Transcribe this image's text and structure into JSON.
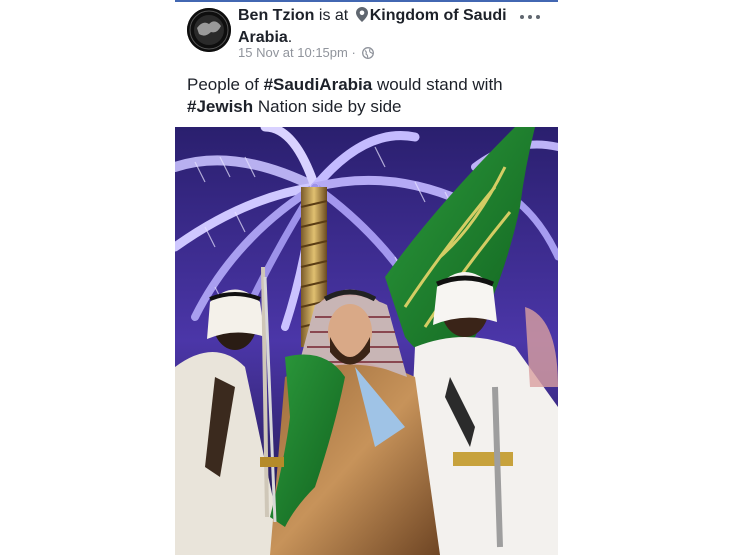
{
  "post": {
    "author": "Ben Tzion",
    "is_at": "is at",
    "location": "Kingdom of Saudi Arabia",
    "location_suffix": ".",
    "timestamp": "15 Nov at 10:15pm",
    "separator": "·",
    "privacy_icon": "globe-icon",
    "location_icon": "location-pin-icon",
    "more_icon": "more-options-icon",
    "text": {
      "part1": "People of ",
      "hashtag1": "#SaudiArabia",
      "part2": " would stand with ",
      "hashtag2": "#Jewish",
      "part3": " Nation side by side"
    }
  },
  "colors": {
    "accent": "#4267b2",
    "meta_text": "#90949c",
    "flag_green": "#1b7a2e",
    "palm_purple": "#6b4ad6"
  }
}
